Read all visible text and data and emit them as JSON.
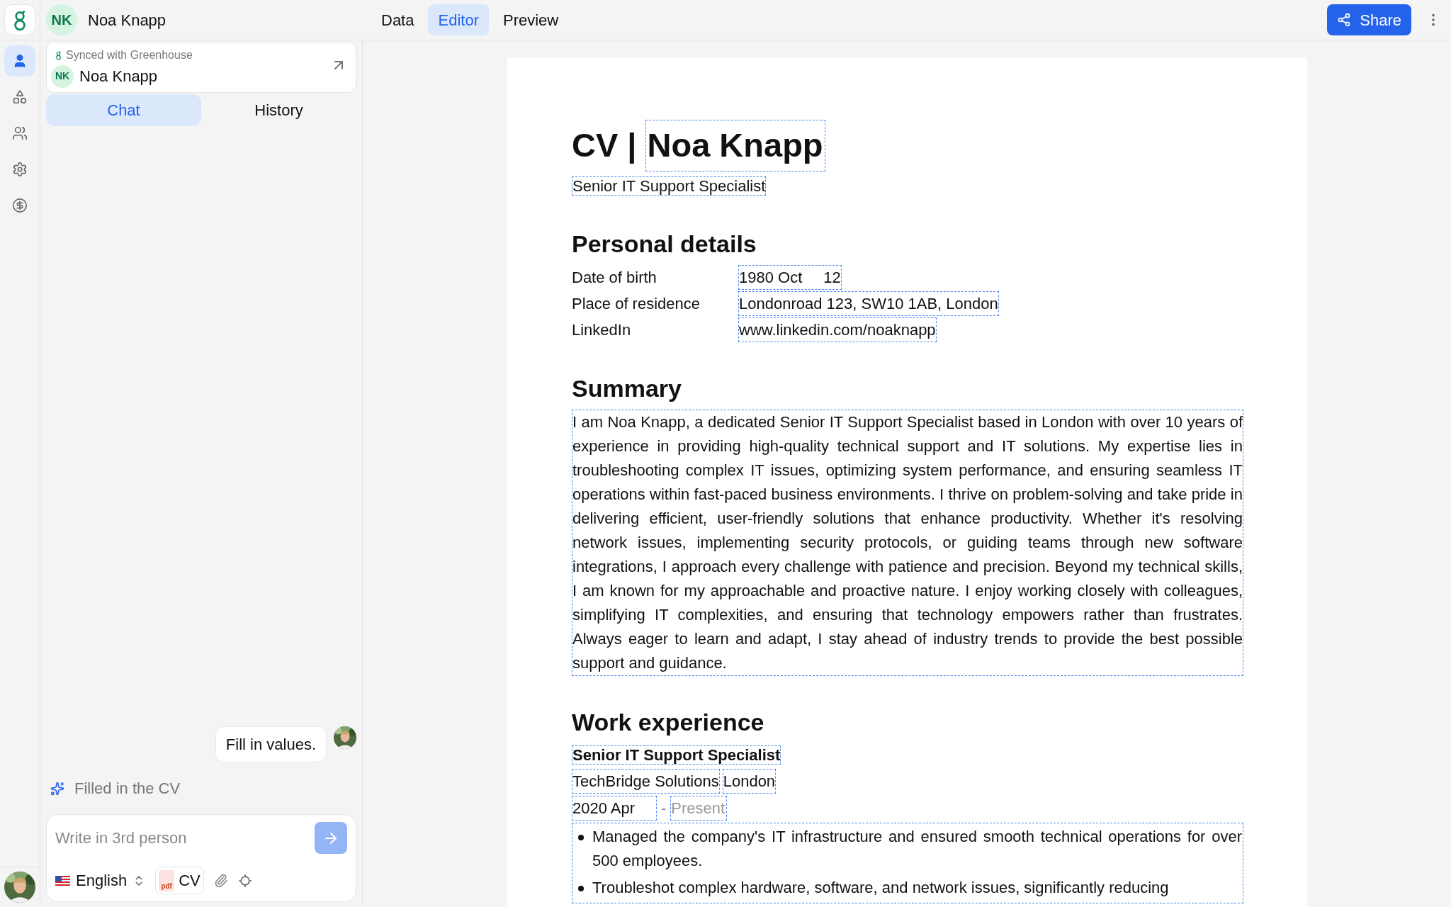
{
  "header": {
    "initials": "NK",
    "name": "Noa Knapp"
  },
  "nav_tabs": [
    {
      "label": "Data",
      "selected": false
    },
    {
      "label": "Editor",
      "selected": true
    },
    {
      "label": "Preview",
      "selected": false
    }
  ],
  "share_button": "Share",
  "rail_items": [
    {
      "kind": "person",
      "selected": true
    },
    {
      "kind": "shapes",
      "selected": false
    },
    {
      "kind": "people",
      "selected": false
    },
    {
      "kind": "settings",
      "selected": false
    },
    {
      "kind": "billing",
      "selected": false
    }
  ],
  "candidate_card": {
    "sync_status": "Synced with Greenhouse",
    "initials": "NK",
    "name": "Noa Knapp"
  },
  "panel_tabs": [
    {
      "label": "Chat",
      "selected": true
    },
    {
      "label": "History",
      "selected": false
    }
  ],
  "messages": [
    {
      "kind": "user",
      "text": "Fill in values."
    },
    {
      "kind": "status",
      "text": "Filled in the CV"
    }
  ],
  "composer": {
    "placeholder": "Write in 3rd person",
    "language": "English",
    "attachment": {
      "file_type": "pdf",
      "label": "CV"
    }
  },
  "document": {
    "title_prefix": "CV |",
    "name": "Noa Knapp",
    "job_title": "Senior IT Support Specialist",
    "sections": [
      {
        "kind": "details",
        "heading": "Personal details",
        "rows": [
          {
            "label": "Date of birth",
            "value": [
              "1980 Oct",
              "12"
            ]
          },
          {
            "label": "Place of residence",
            "value": [
              "Londonroad 123, SW10 1AB, London"
            ]
          },
          {
            "label": "LinkedIn",
            "value": [
              "www.linkedin.com/noaknapp"
            ]
          }
        ]
      },
      {
        "kind": "text",
        "heading": "Summary",
        "text": "I am Noa Knapp, a dedicated Senior IT Support Specialist based in London with over 10 years of experience in providing high-quality technical support and IT solutions. My expertise lies in troubleshooting complex IT issues, optimizing system performance, and ensuring seamless IT operations within fast-paced business environments. I thrive on problem-solving and take pride in delivering efficient, user-friendly solutions that enhance productivity. Whether it's resolving network issues, implementing security protocols, or guiding teams through new software integrations, I approach every challenge with patience and precision. Beyond my technical skills, I am known for my approachable and proactive nature. I enjoy working closely with colleagues, simplifying IT complexities, and ensuring that technology empowers rather than frustrates. Always eager to learn and adapt, I stay ahead of industry trends to provide the best possible support and guidance."
      },
      {
        "kind": "jobs",
        "heading": "Work experience",
        "jobs": [
          {
            "role": "Senior IT Support Specialist",
            "company": "TechBridge Solutions",
            "location": "London",
            "start": "2020 Apr",
            "separator": "-",
            "end_placeholder": "Present",
            "bullets": [
              "Managed the company's IT infrastructure and ensured smooth technical operations for over 500 employees.",
              "Troubleshot complex hardware, software, and network issues, significantly reducing"
            ]
          }
        ]
      }
    ]
  }
}
